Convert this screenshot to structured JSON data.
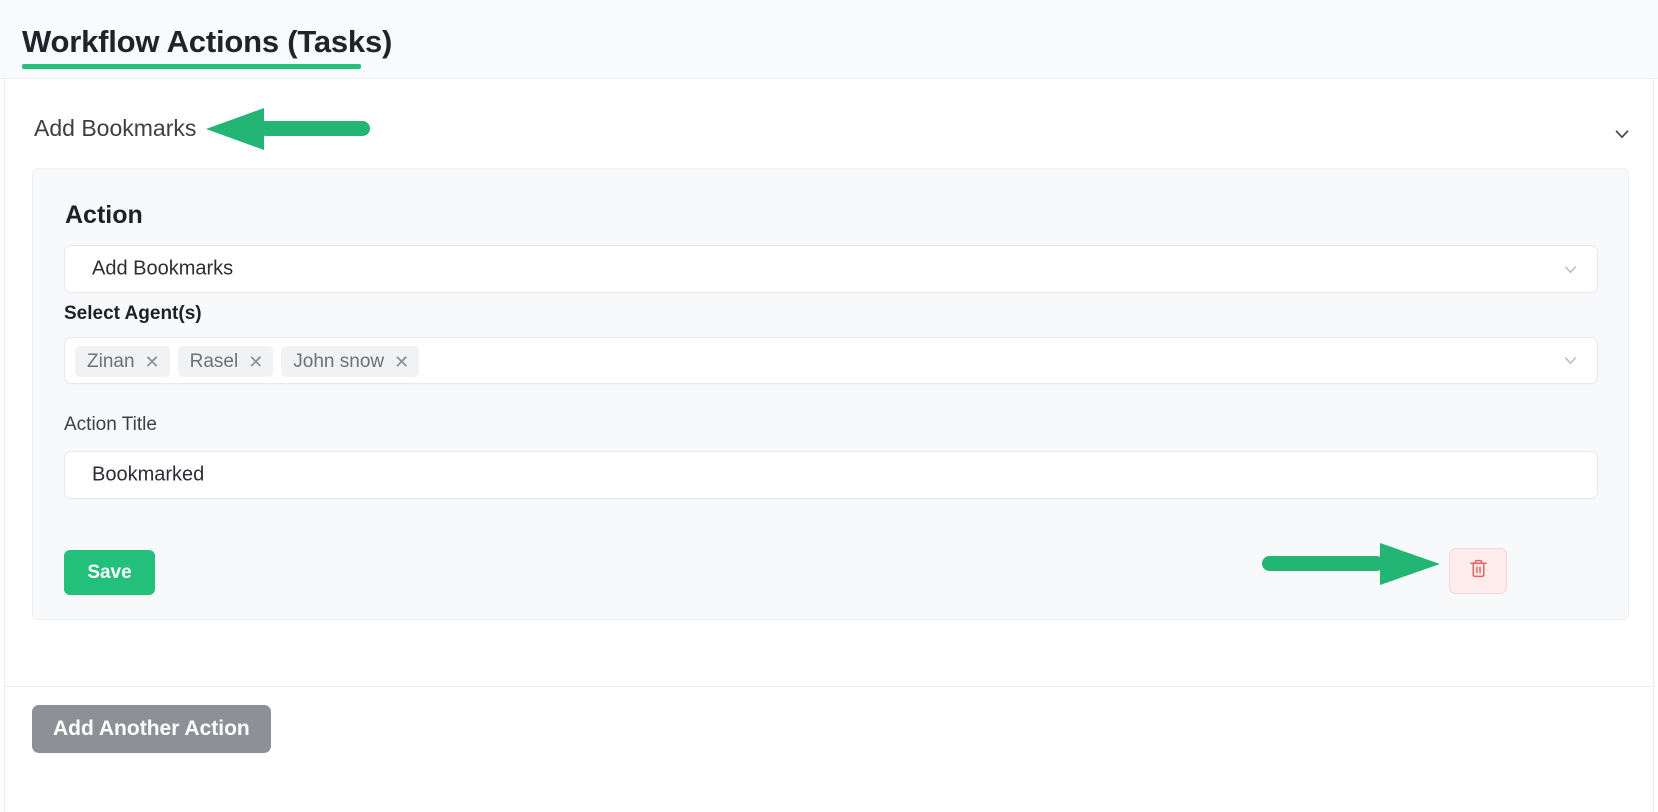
{
  "header": {
    "title": "Workflow Actions (Tasks)",
    "accent_color": "#22c07a"
  },
  "accordion": {
    "label": "Add Bookmarks",
    "chevron_icon": "chevron-down-icon"
  },
  "action_card": {
    "heading": "Action",
    "action_select": {
      "label": "",
      "value": "Add Bookmarks",
      "chevron_icon": "chevron-down-icon"
    },
    "agents_field": {
      "label": "Select Agent(s)",
      "tags": [
        {
          "name": "Zinan",
          "remove_icon": "close-icon"
        },
        {
          "name": "Rasel",
          "remove_icon": "close-icon"
        },
        {
          "name": "John snow",
          "remove_icon": "close-icon"
        }
      ],
      "chevron_icon": "chevron-down-icon"
    },
    "title_field": {
      "label": "Action Title",
      "value": "Bookmarked"
    },
    "save_label": "Save",
    "delete_icon": "trash-icon",
    "save_color": "#22c07a",
    "delete_color": "#e8615f"
  },
  "footer": {
    "add_another_label": "Add Another Action",
    "add_another_color": "#8d9096"
  },
  "annotations": {
    "arrow_left_name": "annotation-arrow-pointing-to-add-bookmarks",
    "arrow_right_name": "annotation-arrow-pointing-to-delete-button",
    "arrow_color": "#22b573"
  }
}
